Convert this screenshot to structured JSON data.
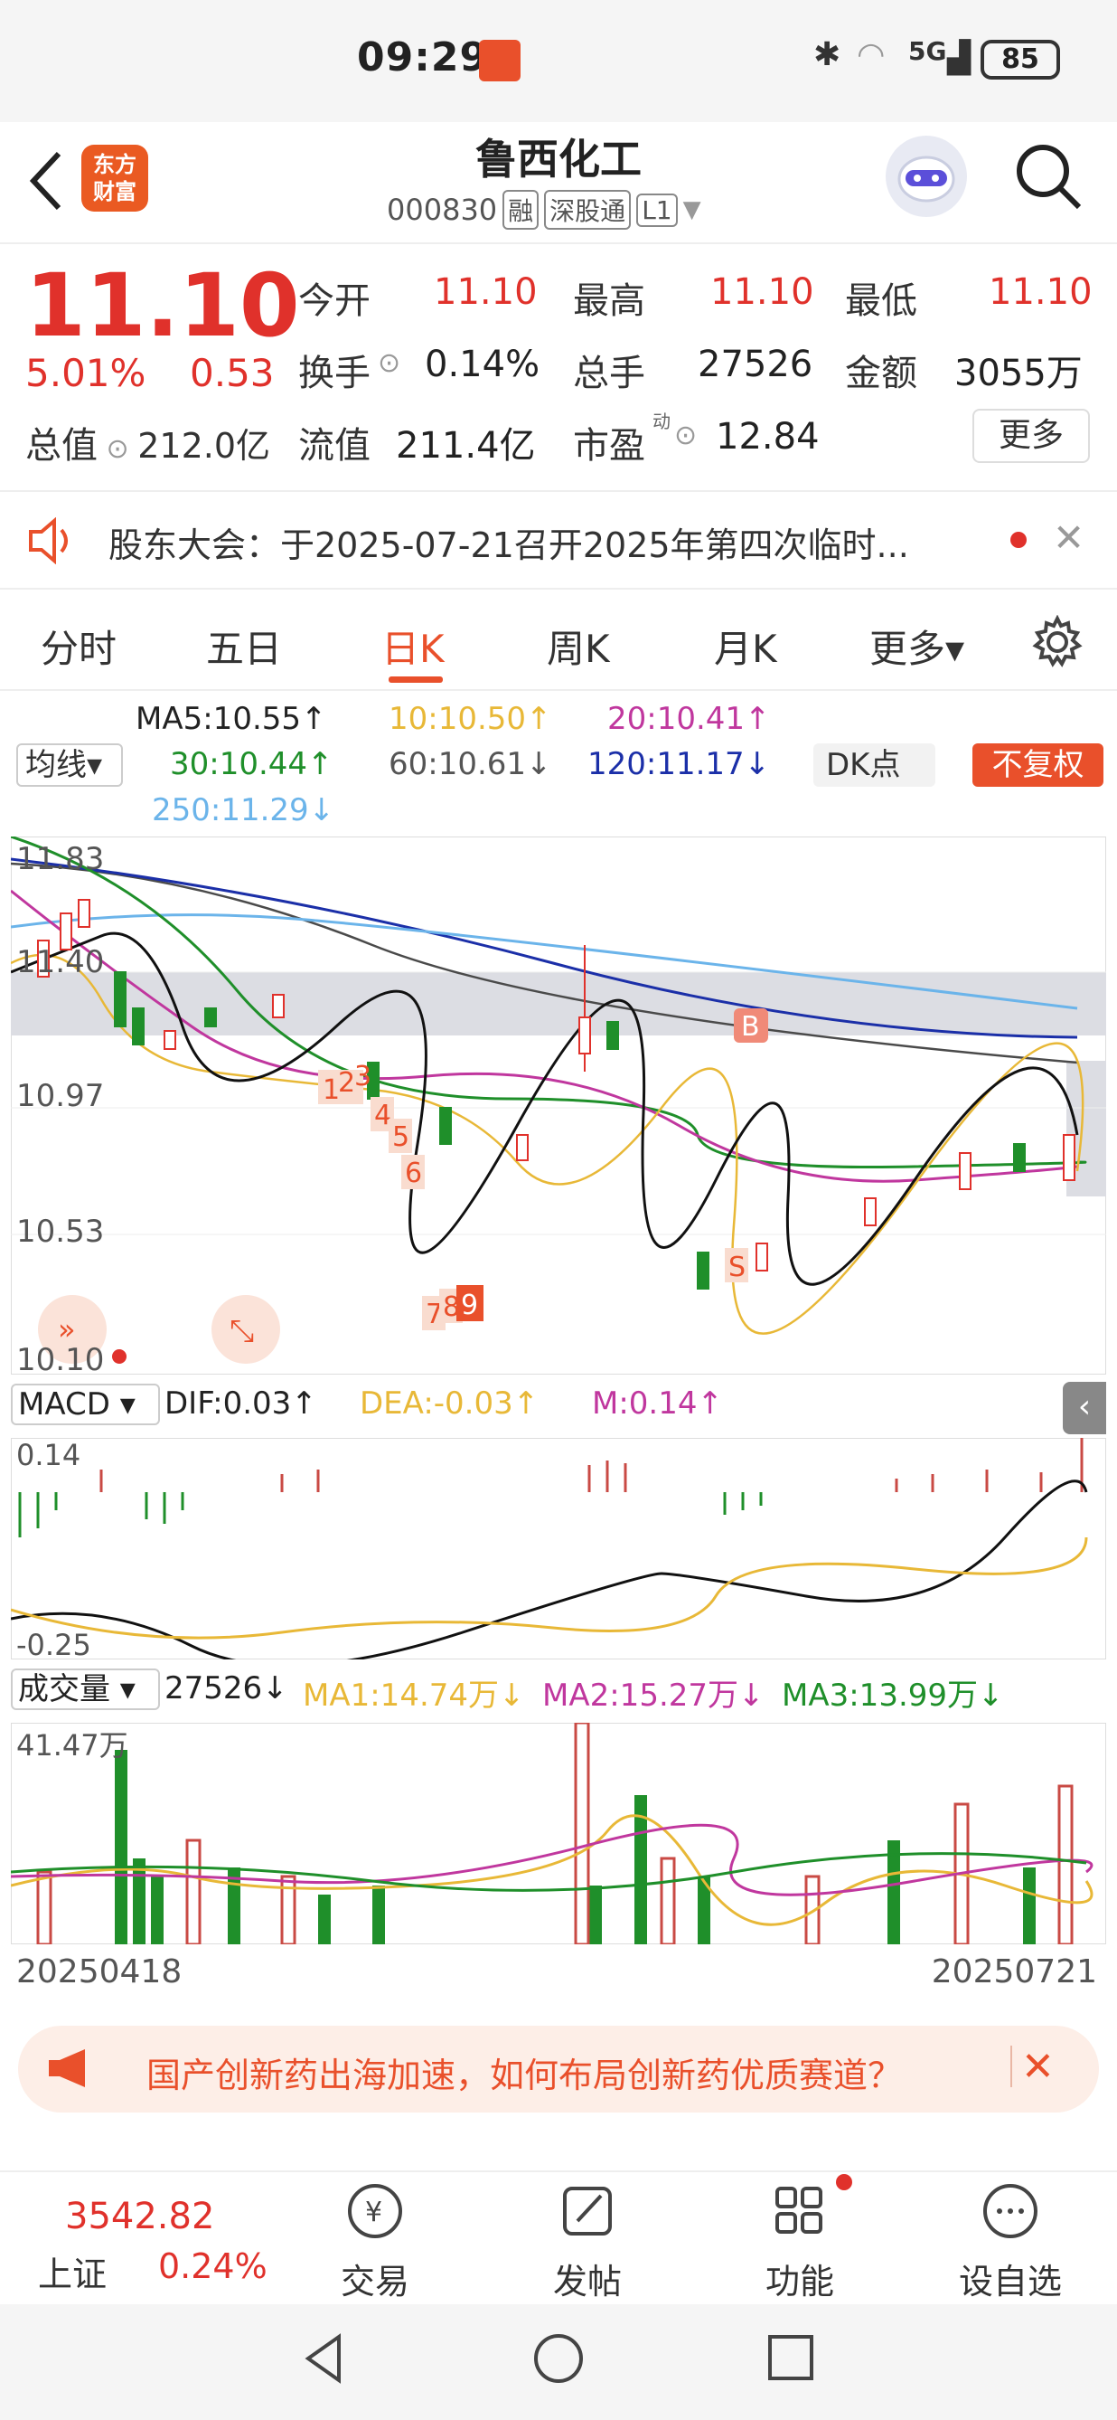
{
  "status_bar": {
    "time": "09:29",
    "network": "5G",
    "battery": "85"
  },
  "header": {
    "stock_name": "鲁西化工",
    "stock_code": "000830",
    "tags": [
      "融",
      "深股通",
      "L1"
    ],
    "logo_text_1": "东方",
    "logo_text_2": "财富"
  },
  "quote": {
    "price": "11.10",
    "change_pct": "5.01%",
    "change_amt": "0.53",
    "total_value_label": "总值",
    "total_value": "212.0亿",
    "open_label": "今开",
    "open": "11.10",
    "high_label": "最高",
    "high": "11.10",
    "low_label": "最低",
    "low": "11.10",
    "turnover_label": "换手",
    "turnover": "0.14%",
    "volume_label": "总手",
    "volume": "27526",
    "amount_label": "金额",
    "amount": "3055万",
    "float_label": "流值",
    "float_value": "211.4亿",
    "pe_label": "市盈",
    "pe_sup": "动",
    "pe": "12.84",
    "more_label": "更多"
  },
  "notice": {
    "text": "股东大会：于2025-07-21召开2025年第四次临时..."
  },
  "tabs": [
    {
      "label": "分时"
    },
    {
      "label": "五日"
    },
    {
      "label": "日K"
    },
    {
      "label": "周K"
    },
    {
      "label": "月K"
    },
    {
      "label": "更多▾"
    }
  ],
  "ma_legend": {
    "selector": "均线▾",
    "ma5": "MA5:10.55↑",
    "ma10": "10:10.50↑",
    "ma20": "20:10.41↑",
    "ma30": "30:10.44↑",
    "ma60": "60:10.61↓",
    "ma120": "120:11.17↓",
    "ma250": "250:11.29↓",
    "dk_label": "DK点",
    "fuquan_label": "不复权"
  },
  "kchart": {
    "y_labels": [
      "11.83",
      "11.40",
      "10.97",
      "10.53",
      "10.10"
    ],
    "markers": [
      "1",
      "2",
      "3",
      "4",
      "5",
      "6",
      "7",
      "8",
      "9",
      "B",
      "S"
    ]
  },
  "macd": {
    "selector": "MACD ▾",
    "dif": "DIF:0.03↑",
    "dea": "DEA:-0.03↑",
    "m": "M:0.14↑",
    "y_top": "0.14",
    "y_bottom": "-0.25"
  },
  "volume": {
    "selector": "成交量 ▾",
    "value": "27526↓",
    "ma1": "MA1:14.74万↓",
    "ma2": "MA2:15.27万↓",
    "ma3": "MA3:13.99万↓",
    "y_top": "41.47万"
  },
  "dates": {
    "start": "20250418",
    "end": "20250721"
  },
  "promo": {
    "text": "国产创新药出海加速，如何布局创新药优质赛道？"
  },
  "bottom_nav": {
    "index_value": "3542.82",
    "index_name": "上证",
    "index_pct": "0.24%",
    "items": [
      {
        "label": "交易"
      },
      {
        "label": "发帖"
      },
      {
        "label": "功能"
      },
      {
        "label": "设自选"
      }
    ]
  },
  "colors": {
    "up": "#e0312b",
    "down": "#1f8f2a",
    "accent": "#e9502b"
  }
}
